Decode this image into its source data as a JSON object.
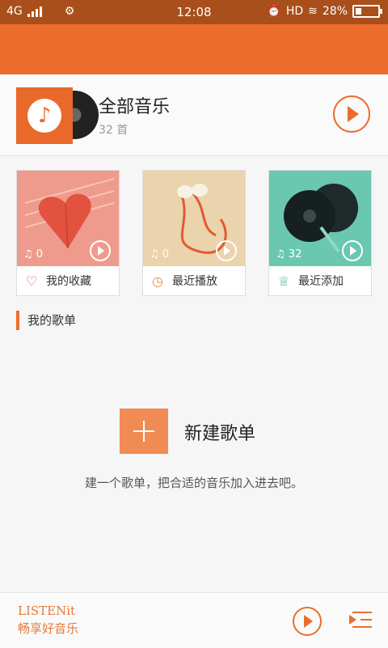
{
  "status": {
    "network": "4G",
    "time": "12:08",
    "hd": "HD",
    "battery": "28%"
  },
  "all_music": {
    "title": "全部音乐",
    "count": "32 首"
  },
  "tiles": [
    {
      "label": "我的收藏",
      "count": "0",
      "icon": "heart-icon"
    },
    {
      "label": "最近播放",
      "count": "0",
      "icon": "clock-icon"
    },
    {
      "label": "最近添加",
      "count": "32",
      "icon": "crown-icon"
    }
  ],
  "section_title": "我的歌单",
  "new_playlist": {
    "label": "新建歌单",
    "hint": "建一个歌单，把合适的音乐加入进去吧。"
  },
  "bottom": {
    "brand": "LISTENit",
    "slogan": "畅享好音乐"
  },
  "colors": {
    "accent": "#ec6d2b",
    "status_bar": "#a84f1b"
  }
}
